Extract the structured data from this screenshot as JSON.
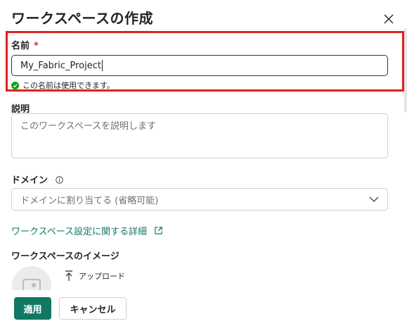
{
  "dialog": {
    "title": "ワークスペースの作成",
    "close_icon": "close-icon"
  },
  "name_field": {
    "label": "名前",
    "required_mark": "*",
    "value": "My_Fabric_Project",
    "validation_message": "この名前は使用できます。",
    "validation_icon": "check-circle-icon",
    "validation_color": "#13a10e"
  },
  "description_field": {
    "label": "説明",
    "placeholder": "このワークスペースを説明します"
  },
  "domain_field": {
    "label": "ドメイン",
    "info_icon": "info-icon",
    "placeholder": "ドメインに割り当てる (省略可能)",
    "dropdown_icon": "chevron-down-icon"
  },
  "settings_link": {
    "label": "ワークスペース設定に関する詳細",
    "icon": "open-external-icon",
    "color": "#117865"
  },
  "image_section": {
    "label": "ワークスペースのイメージ",
    "upload_label": "アップロード",
    "upload_icon": "upload-arrow-icon"
  },
  "footer": {
    "apply_label": "適用",
    "cancel_label": "キャンセル",
    "primary_color": "#117865"
  },
  "highlight_color": "#e0211d"
}
